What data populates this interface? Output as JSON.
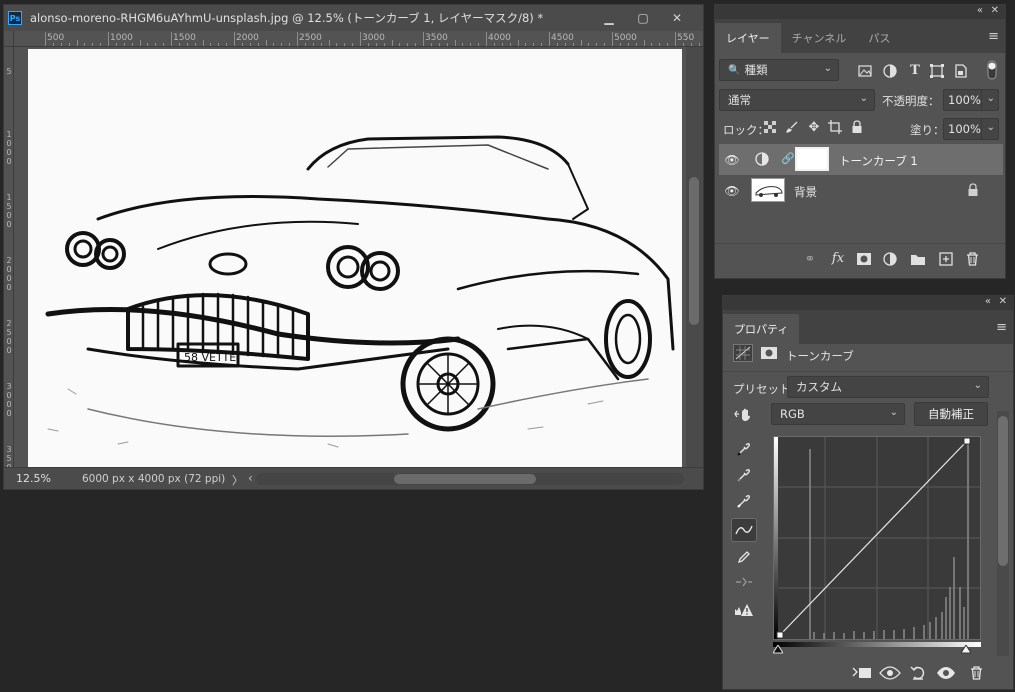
{
  "document": {
    "title": "alonso-moreno-RHGM6uAYhmU-unsplash.jpg @ 12.5% (トーンカーブ 1, レイヤーマスク/8) *",
    "ps_icon": "Ps",
    "window_buttons": {
      "minimize": "▁",
      "maximize": "▢",
      "close": "✕"
    },
    "ruler_h_ticks": [
      "500",
      "1000",
      "1500",
      "2000",
      "2500",
      "3000",
      "3500",
      "4000",
      "4500",
      "5000",
      "550"
    ],
    "ruler_v_ticks": [
      "5",
      "1 0 0 0",
      "1 5 0 0",
      "2 0 0 0",
      "2 5 0 0",
      "3 0 0 0",
      "3 5 0 0"
    ],
    "status_zoom": "12.5%",
    "status_info": "6000 px x 4000 px (72 ppi)",
    "status_arrow": "〉",
    "hscroll_left_arrow": "‹"
  },
  "layers_panel": {
    "collapse_glyph": "«",
    "close_glyph": "✕",
    "tabs": [
      {
        "label": "レイヤー",
        "active": true
      },
      {
        "label": "チャンネル",
        "active": false
      },
      {
        "label": "パス",
        "active": false
      }
    ],
    "menu_icon": "≡",
    "filter_value": "種類",
    "blend_mode": "通常",
    "opacity_label": "不透明度：",
    "opacity_value": "100%",
    "lock_label": "ロック：",
    "fill_label": "塗り：",
    "fill_value": "100%",
    "layers": [
      {
        "name": "トーンカーブ 1",
        "selected": true
      },
      {
        "name": "背景",
        "selected": false,
        "locked": true
      }
    ]
  },
  "properties_panel": {
    "collapse_glyph": "«",
    "close_glyph": "✕",
    "tab_label": "プロパティ",
    "menu_icon": "≡",
    "adjustment_name": "トーンカーブ",
    "preset_label": "プリセット：",
    "preset_value": "カスタム",
    "channel_value": "RGB",
    "auto_button": "自動補正"
  }
}
